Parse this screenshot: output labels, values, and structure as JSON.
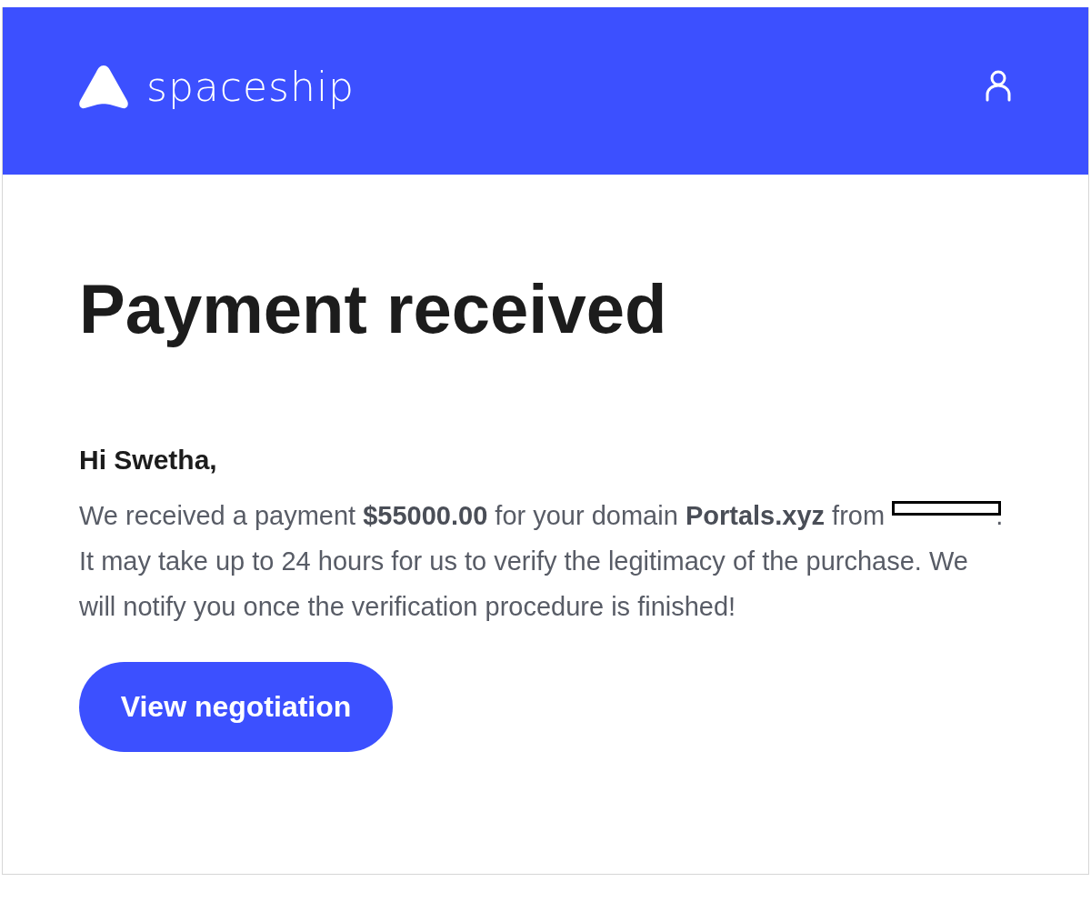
{
  "header": {
    "logo_text": "spaceship"
  },
  "title": "Payment received",
  "greeting": "Hi Swetha,",
  "message": {
    "before": "We received a payment **$55000.00** for your domain **Portals.xyz** from",
    "redacted": true,
    "after": ". It may take up to 24 hours for us to verify the legitimacy of the purchase. We will notify you once the verification procedure is finished!"
  },
  "button": {
    "label": "View negotiation"
  }
}
